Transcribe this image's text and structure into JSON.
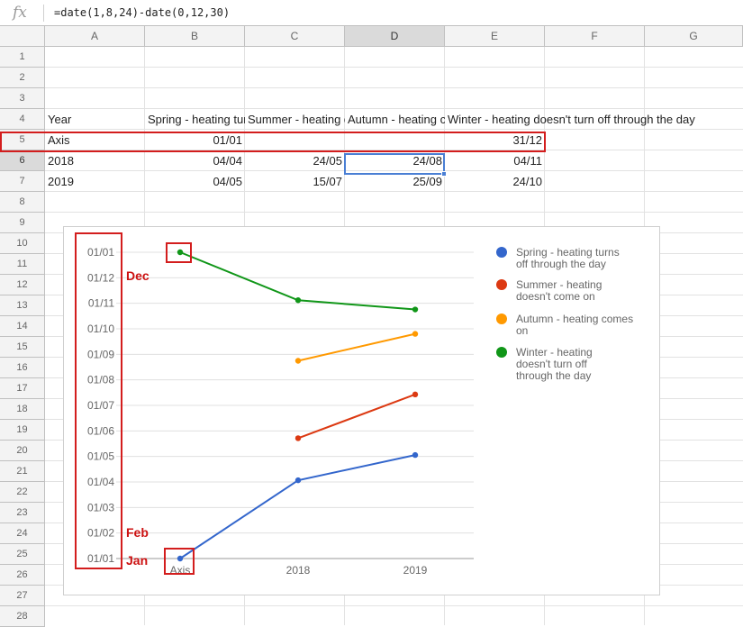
{
  "formula_bar": {
    "icon": "fx-icon",
    "formula": "=date(1,8,24)-date(0,12,30)"
  },
  "columns": [
    "A",
    "B",
    "C",
    "D",
    "E",
    "F",
    "G"
  ],
  "rows": [
    "1",
    "2",
    "3",
    "4",
    "5",
    "6",
    "7",
    "8",
    "9",
    "10",
    "11",
    "12",
    "13",
    "14",
    "15",
    "16",
    "17",
    "18",
    "19",
    "20",
    "21",
    "22",
    "23",
    "24",
    "25",
    "26",
    "27",
    "28"
  ],
  "cells": {
    "a4": "Year",
    "b4": "Spring - heating turns off through the day",
    "c4": "Summer - heating doesn't come on",
    "d4": "Autumn - heating comes on",
    "e4": "Winter - heating doesn't turn off through the day",
    "a5": "Axis",
    "b5": "01/01",
    "e5": "31/12",
    "a6": "2018",
    "b6": "04/04",
    "c6": "24/05",
    "d6": "24/08",
    "e6": "04/11",
    "a7": "2019",
    "b7": "04/05",
    "c7": "15/07",
    "d7": "25/09",
    "e7": "24/10"
  },
  "chart_data": {
    "type": "line",
    "categories": [
      "Axis",
      "2018",
      "2019"
    ],
    "y_ticks": [
      "01/01",
      "01/02",
      "01/03",
      "01/04",
      "01/05",
      "01/06",
      "01/07",
      "01/08",
      "01/09",
      "01/10",
      "01/11",
      "01/12",
      "01/01"
    ],
    "ylim": [
      "01/01",
      "31/12"
    ],
    "legend_position": "right",
    "series": [
      {
        "name": "Spring - heating turns off through the day",
        "color": "#3366cc",
        "values": [
          "01/01",
          "04/04",
          "04/05"
        ]
      },
      {
        "name": "Summer - heating doesn't come on",
        "color": "#dc3912",
        "values": [
          null,
          "24/05",
          "15/07"
        ]
      },
      {
        "name": "Autumn - heating comes on",
        "color": "#ff9900",
        "values": [
          null,
          "24/08",
          "25/09"
        ]
      },
      {
        "name": "Winter - heating doesn't turn off through the day",
        "color": "#109618",
        "values": [
          "31/12",
          "04/11",
          "24/10"
        ]
      }
    ]
  },
  "annotations": {
    "dec": "Dec",
    "feb": "Feb",
    "jan": "Jan"
  },
  "colors": {
    "annotation": "#d31d1d",
    "selection": "#4a7fd4"
  }
}
